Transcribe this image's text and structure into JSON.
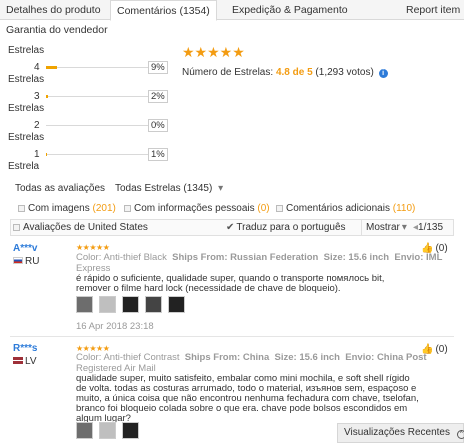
{
  "tabs": [
    {
      "label": "Detalhes do produto"
    },
    {
      "label": "Comentários (1354)"
    },
    {
      "label": "Expedição & Pagamento"
    },
    {
      "label": "Report item"
    },
    {
      "label": "Garantia do vendedor"
    }
  ],
  "ratings": [
    {
      "word": "Estrelas",
      "number": "4",
      "percent_label": "9%",
      "fill_fraction": 0.09
    },
    {
      "word": "Estrelas",
      "number": "3",
      "percent_label": "2%",
      "fill_fraction": 0.02
    },
    {
      "word": "Estrelas",
      "number": "2",
      "percent_label": "0%",
      "fill_fraction": 0.0
    },
    {
      "word": "Estrelas",
      "number": "1",
      "percent_label": "1%",
      "fill_fraction": 0.01
    },
    {
      "word": "Estrela",
      "number": "",
      "percent_label": "",
      "fill_fraction": 0.0
    }
  ],
  "header_word": "Estrelas",
  "summary": {
    "stars": "★★★★★",
    "label": "Número de Estrelas:",
    "score": "4.8 de 5",
    "votes": "(1,293 votos)",
    "info_icon": "i"
  },
  "filters": {
    "label": "Todas as avaliações",
    "select": "Todas Estrelas (1345)",
    "select_arrow": "▾",
    "with_images": "Com imagens",
    "with_images_count": "(201)",
    "personal_info": "Com informações pessoais",
    "personal_info_count": "(0)",
    "additional": "Comentários adicionais",
    "additional_count": "(110)"
  },
  "sortbar": {
    "us_reviews": "Avaliações de United States",
    "translate": "Traduz para o português",
    "show": "Mostrar",
    "show_arrow": "▾",
    "pagination": "1/135"
  },
  "reviews": [
    {
      "name": "A***v",
      "country": "RU",
      "stars": "★★★★★",
      "meta_line1_color": "Color: Anti-thief Black",
      "meta_line1_ships": "Ships From: Russian Federation",
      "meta_line1_size": "Size: 15.6 inch",
      "meta_line1_envio": "Envio: IML",
      "meta_line2": "Express",
      "text_line1": "é rápido o suficiente, qualidade super, quando o transporte помялось bit,",
      "text_line2": "remover o filme hard lock (necessidade de chave de bloqueio).",
      "date": "16 Apr 2018 23:18",
      "helpful": "(0)"
    },
    {
      "name": "R***s",
      "country": "LV",
      "stars": "★★★★★",
      "meta_line1_color": "Color: Anti-thief Contrast",
      "meta_line1_ships": "Ships From: China",
      "meta_line1_size": "Size: 15.6 inch",
      "meta_line1_envio": "Envio: China Post",
      "meta_line2": "Registered Air Mail",
      "text_line1": "qualidade super, muito satisfeito, embalar como mini mochila, e soft shell rígido",
      "text_line2": "de volta. todas as costuras arrumado, todo o material, изъянов sem, espaçoso e",
      "text_line3": "muito, a única coisa que não encontrou nenhuma fechadura com chave, tselofan,",
      "text_line4": "branco foi bloqueio colada sobre o que era. chave pode bolsos escondidos em",
      "text_line5": "algum lugar?",
      "helpful": "(0)"
    }
  ],
  "recent": {
    "label": "Visualizações Recentes",
    "arrow": "^"
  }
}
